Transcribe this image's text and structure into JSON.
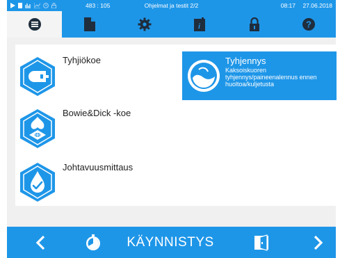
{
  "statusbar": {
    "icons": [
      "play-icon",
      "file-icon",
      "signal-icon",
      "chart-icon",
      "clock-icon",
      "lock-small-icon"
    ],
    "coords": "483 : 105",
    "title": "Ohjelmat ja testit 2/2",
    "time": "08:17",
    "date": "27.06.2018"
  },
  "tabs": [
    {
      "icon": "list-icon",
      "active": true
    },
    {
      "icon": "document-icon",
      "active": false
    },
    {
      "icon": "gear-icon",
      "active": false
    },
    {
      "icon": "info-book-icon",
      "active": false
    },
    {
      "icon": "padlock-icon",
      "active": false
    },
    {
      "icon": "help-icon",
      "active": false
    }
  ],
  "programs": [
    {
      "label": "Tyhjiökoe",
      "icon": "vacuum-test-icon"
    },
    {
      "label": "Bowie&Dick -koe",
      "icon": "bowie-dick-icon"
    },
    {
      "label": "Johtavuusmittaus",
      "icon": "conductivity-icon"
    }
  ],
  "selected": {
    "title": "Tyhjennys",
    "description": "Kaksoiskuoren tyhjennys/paineenalennus ennen huoltoa/kuljetusta",
    "icon": "drain-icon"
  },
  "bottombar": {
    "start_label": "KÄYNNISTYS"
  },
  "colors": {
    "accent": "#1e96e8",
    "text": "#222222",
    "icon_dark": "#1f2d3d"
  }
}
